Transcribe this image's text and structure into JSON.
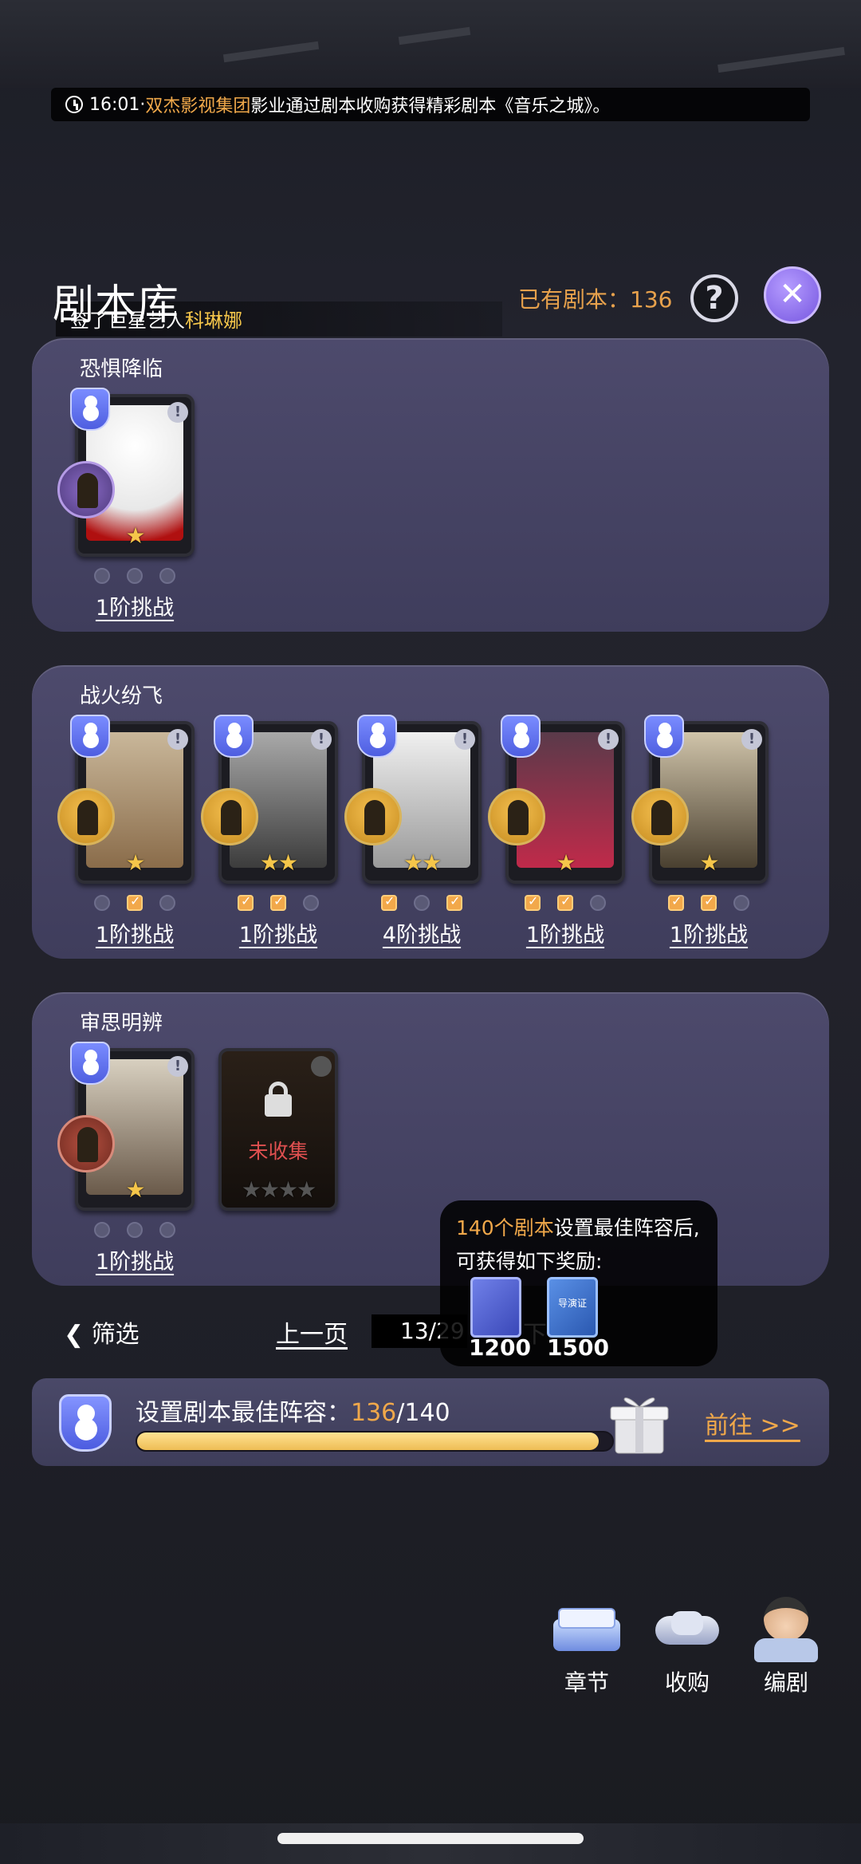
{
  "ticker": {
    "time": "16:01",
    "sep": " · ",
    "company": "双杰影视集团",
    "message": "影业通过剧本收购获得精彩剧本《音乐之城》。"
  },
  "header": {
    "title": "剧本库",
    "sub_prefix": "签了巨星艺人",
    "sub_name": "科琳娜",
    "owned_label": "已有剧本：",
    "owned_count": "136"
  },
  "groups": [
    {
      "name": "恐惧降临",
      "cards": [
        {
          "stars": "★",
          "challenge": "1阶挑战",
          "dots": [
            0,
            0,
            0
          ],
          "role": "purple"
        }
      ]
    },
    {
      "name": "战火纷飞",
      "cards": [
        {
          "stars": "★",
          "challenge": "1阶挑战",
          "dots": [
            0,
            1,
            0
          ]
        },
        {
          "stars": "★★",
          "challenge": "1阶挑战",
          "dots": [
            1,
            1,
            0
          ]
        },
        {
          "stars": "★★",
          "challenge": "4阶挑战",
          "dots": [
            1,
            0,
            1
          ]
        },
        {
          "stars": "★",
          "challenge": "1阶挑战",
          "dots": [
            1,
            1,
            0
          ]
        },
        {
          "stars": "★",
          "challenge": "1阶挑战",
          "dots": [
            1,
            1,
            0
          ]
        }
      ]
    },
    {
      "name": "审思明辨",
      "cards": [
        {
          "stars": "★",
          "challenge": "1阶挑战",
          "dots": [
            0,
            0,
            0
          ],
          "role": "red"
        },
        {
          "locked": true,
          "locked_label": "未收集"
        }
      ]
    }
  ],
  "nav": {
    "filter": "筛选",
    "prev": "上一页",
    "page": "13/29",
    "next": "下"
  },
  "popup": {
    "count_text": "140个剧本",
    "line1_rest": "设置最佳阵容后,",
    "line2": "可获得如下奖励:",
    "reward1": "1200",
    "reward2": "1500",
    "book2_label": "导演证"
  },
  "progress": {
    "label": "设置剧本最佳阵容：",
    "current": "136",
    "total": "/140",
    "fraction": 0.971,
    "goto": "前往 >>"
  },
  "dock": [
    {
      "label": "章节",
      "icon": "book-stack-icon"
    },
    {
      "label": "收购",
      "icon": "handshake-icon"
    },
    {
      "label": "编剧",
      "icon": "writer-avatar-icon"
    }
  ],
  "colors": {
    "accent_orange": "#f0a84a",
    "gold": "#f5c64a",
    "panel": "#45435f",
    "close": "#7d5fe6"
  }
}
